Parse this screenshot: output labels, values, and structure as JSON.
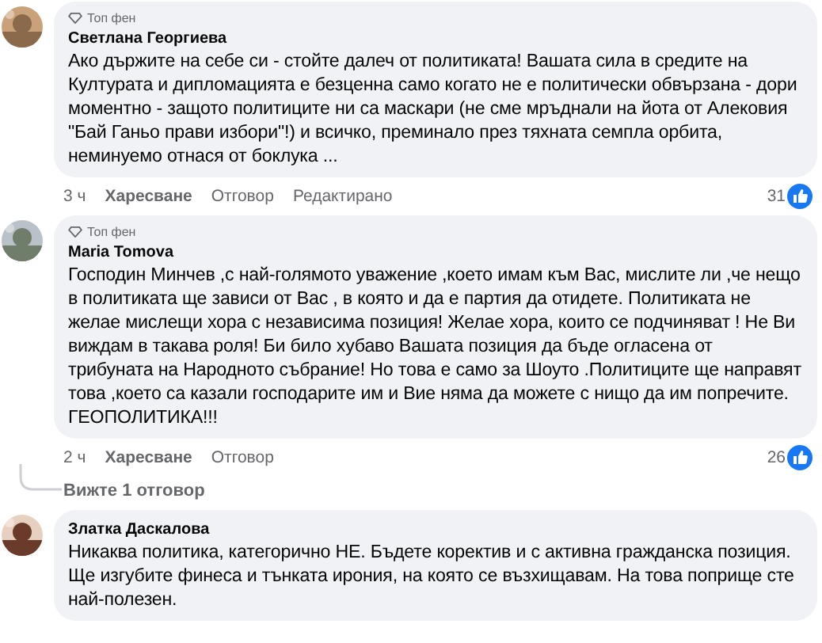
{
  "comments": [
    {
      "badge": "Топ фен",
      "author": "Светлана Георгиева",
      "text": "Ако държите на себе си - стойте далеч от политиката! Вашата сила в средите на Културата и дипломацията е безценна само когато не е политически обвързана - дори моментно - защото политиците ни са маскари (не сме мръднали на йота от Алековия \"Бай Ганьо прави избори\"!) и всичко, преминало през тяхната семпла орбита, неминуемо отнася от боклука ...",
      "time": "3 ч",
      "actions": [
        "Харесване",
        "Отговор",
        "Редактирано"
      ],
      "reactions": "31"
    },
    {
      "badge": "Топ фен",
      "author": "Maria Tomova",
      "text": "Господин Минчев ,с най-голямото уважение ,което имам към Вас, мислите ли ,че нещо в политиката ще зависи от Вас , в която и да е партия да отидете. Политиката не желае мислещи хора с независима позиция! Желае хора, които се подчиняват ! Не Ви виждам в такава роля! Би било хубаво Вашата позиция да бъде огласена от трибуната на Народното събрание! Но това е само за Шоуто .Политиците ще направят това ,което са казали господарите им и Вие няма да можете с нищо да им попречите. ГЕОПОЛИТИКА!!!",
      "time": "2 ч",
      "actions": [
        "Харесване",
        "Отговор"
      ],
      "reactions": "26",
      "replies_link": "Вижте 1 отговор"
    },
    {
      "author": "Златка Даскалова",
      "text": "Никаква политика, категорично НЕ. Бъдете коректив и с активна гражданска позиция. Ще изгубите финеса и тънката ирония, на която се възхищавам. На това поприще сте най-полезен."
    }
  ]
}
